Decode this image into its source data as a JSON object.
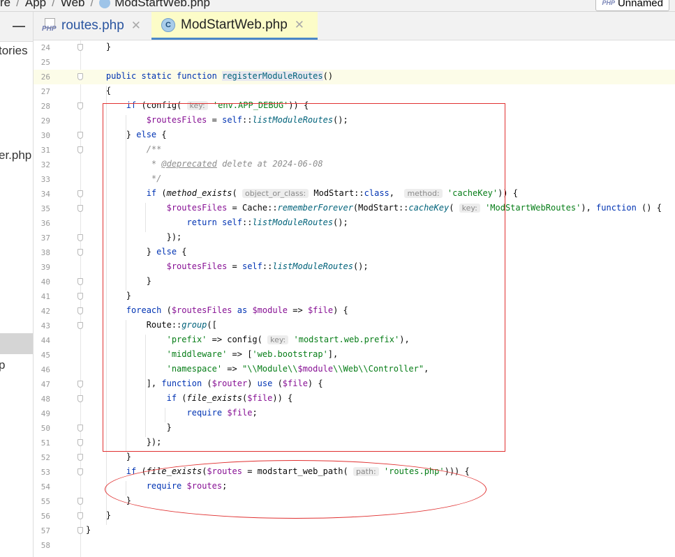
{
  "breadcrumb": {
    "parts": [
      "re",
      "App",
      "Web",
      "ModStartWeb.php"
    ],
    "run_config": "Unnamed"
  },
  "project_panel": {
    "snippets": [
      "tories",
      "er.php",
      "p"
    ]
  },
  "tabs": [
    {
      "label": "routes.php",
      "active": false,
      "icon": "php-file-icon"
    },
    {
      "label": "ModStartWeb.php",
      "active": true,
      "icon": "class-icon"
    }
  ],
  "editor": {
    "current_line": 26,
    "lines": [
      {
        "n": 24,
        "html": "    }"
      },
      {
        "n": 25,
        "html": ""
      },
      {
        "n": 26,
        "html": "    <span class='kw'>public static function</span> <span class='fn' style='background:#e8e8f0'>registerModuleRoutes</span>()"
      },
      {
        "n": 27,
        "html": "    {"
      },
      {
        "n": 28,
        "html": "        <span class='kw'>if</span> (config( <span class='hint'>key:</span> <span class='str'>'env.APP_DEBUG'</span>)) {"
      },
      {
        "n": 29,
        "html": "            <span class='var'>$routesFiles</span> = <span class='kw'>self</span>::<span class='fn ital'>listModuleRoutes</span>();"
      },
      {
        "n": 30,
        "html": "        } <span class='kw'>else</span> {"
      },
      {
        "n": 31,
        "html": "            <span class='cm'>/**</span>"
      },
      {
        "n": 32,
        "html": "             <span class='cm'>* <span class='u'>@deprecated</span> delete at 2024-06-08</span>"
      },
      {
        "n": 33,
        "html": "             <span class='cm'>*/</span>"
      },
      {
        "n": 34,
        "html": "            <span class='kw'>if</span> (<span class='ital'>method_exists</span>( <span class='hint'>object_or_class:</span> ModStart::<span class='kw'>class</span>,  <span class='hint'>method:</span> <span class='str'>'cacheKey'</span>)) {"
      },
      {
        "n": 35,
        "html": "                <span class='var'>$routesFiles</span> = Cache::<span class='fn ital'>rememberForever</span>(ModStart::<span class='fn ital'>cacheKey</span>( <span class='hint'>key:</span> <span class='str'>'ModStartWebRoutes'</span>), <span class='kw'>function</span> () {"
      },
      {
        "n": 36,
        "html": "                    <span class='kw'>return</span> <span class='kw'>self</span>::<span class='fn ital'>listModuleRoutes</span>();"
      },
      {
        "n": 37,
        "html": "                });"
      },
      {
        "n": 38,
        "html": "            } <span class='kw'>else</span> {"
      },
      {
        "n": 39,
        "html": "                <span class='var'>$routesFiles</span> = <span class='kw'>self</span>::<span class='fn ital'>listModuleRoutes</span>();"
      },
      {
        "n": 40,
        "html": "            }"
      },
      {
        "n": 41,
        "html": "        }"
      },
      {
        "n": 42,
        "html": "        <span class='kw'>foreach</span> (<span class='var'>$routesFiles</span> <span class='kw'>as</span> <span class='var'>$module</span> => <span class='var'>$file</span>) {"
      },
      {
        "n": 43,
        "html": "            Route::<span class='fn ital'>group</span>(["
      },
      {
        "n": 44,
        "html": "                <span class='str'>'prefix'</span> => config( <span class='hint'>key:</span> <span class='str'>'modstart.web.prefix'</span>),"
      },
      {
        "n": 45,
        "html": "                <span class='str'>'middleware'</span> => [<span class='str'>'web.bootstrap'</span>],"
      },
      {
        "n": 46,
        "html": "                <span class='str'>'namespace'</span> => <span class='str'>\"\\\\Module\\\\<span class='var'>$module</span>\\\\Web\\\\Controller\"</span>,"
      },
      {
        "n": 47,
        "html": "            ], <span class='kw'>function</span> (<span class='var'>$router</span>) <span class='kw'>use</span> (<span class='var'>$file</span>) {"
      },
      {
        "n": 48,
        "html": "                <span class='kw'>if</span> (<span class='ital'>file_exists</span>(<span class='var'>$file</span>)) {"
      },
      {
        "n": 49,
        "html": "                    <span class='kw'>require</span> <span class='var'>$file</span>;"
      },
      {
        "n": 50,
        "html": "                }"
      },
      {
        "n": 51,
        "html": "            });"
      },
      {
        "n": 52,
        "html": "        }"
      },
      {
        "n": 53,
        "html": "        <span class='kw'>if</span> (<span class='ital'>file_exists</span>(<span class='var'>$routes</span> = modstart_web_path( <span class='hint'>path:</span> <span class='str'>'routes.php'</span>))) {"
      },
      {
        "n": 54,
        "html": "            <span class='kw'>require</span> <span class='var'>$routes</span>;"
      },
      {
        "n": 55,
        "html": "        }"
      },
      {
        "n": 56,
        "html": "    }"
      },
      {
        "n": 57,
        "html": "}"
      },
      {
        "n": 58,
        "html": ""
      }
    ]
  },
  "colors": {
    "annotation": "#e03030",
    "active_tab_bg": "#fcfcc8",
    "keyword": "#0033b3",
    "string": "#067d17",
    "variable": "#871094"
  }
}
